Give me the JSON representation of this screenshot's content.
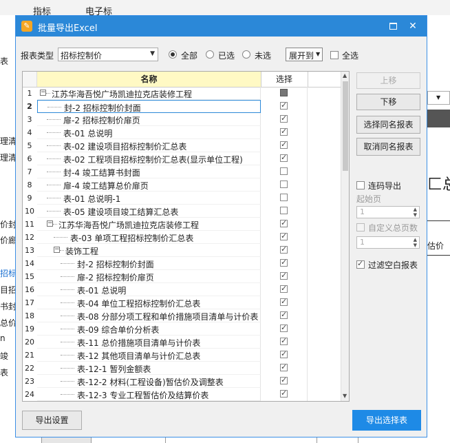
{
  "background": {
    "tabs": [
      "指标",
      "电子标"
    ],
    "left_fragments": [
      {
        "text": "表",
        "blue": false
      },
      {
        "text": "理清",
        "blue": false
      },
      {
        "text": "理清",
        "blue": false
      },
      {
        "text": "价封",
        "blue": false
      },
      {
        "text": "价廊",
        "blue": false
      },
      {
        "text": "招标",
        "blue": true
      },
      {
        "text": "目招",
        "blue": false
      },
      {
        "text": "书封",
        "blue": false
      },
      {
        "text": "总价",
        "blue": false
      },
      {
        "text": "n",
        "blue": false
      },
      {
        "text": "竣",
        "blue": false
      },
      {
        "text": "表",
        "blue": false
      }
    ],
    "right_fragments": [
      "匚总",
      "估价"
    ]
  },
  "dialog": {
    "title": "批量导出Excel",
    "report_type_label": "报表类型",
    "report_type_value": "招标控制价",
    "radio_all": "全部",
    "radio_selected": "已选",
    "radio_unselected": "未选",
    "expand_label": "展开到",
    "select_all_label": "全选",
    "grid": {
      "col_name": "名称",
      "col_select": "选择",
      "rows": [
        {
          "no": "1",
          "level": 0,
          "toggle": "−",
          "text": "江苏华海吾悦广场凯迪拉克店装修工程",
          "state": "partial"
        },
        {
          "no": "2",
          "level": 1,
          "toggle": "",
          "text": "封-2 招标控制价封面",
          "state": "on",
          "current": true
        },
        {
          "no": "3",
          "level": 1,
          "toggle": "",
          "text": "扉-2 招标控制价扉页",
          "state": "on"
        },
        {
          "no": "4",
          "level": 1,
          "toggle": "",
          "text": "表-01 总说明",
          "state": "on"
        },
        {
          "no": "5",
          "level": 1,
          "toggle": "",
          "text": "表-02 建设项目招标控制价汇总表",
          "state": "on"
        },
        {
          "no": "6",
          "level": 1,
          "toggle": "",
          "text": "表-02 工程项目招标控制价汇总表(显示单位工程)",
          "state": "on"
        },
        {
          "no": "7",
          "level": 1,
          "toggle": "",
          "text": "封-4 竣工结算书封面",
          "state": "off"
        },
        {
          "no": "8",
          "level": 1,
          "toggle": "",
          "text": "扉-4 竣工结算总价扉页",
          "state": "off"
        },
        {
          "no": "9",
          "level": 1,
          "toggle": "",
          "text": "表-01 总说明-1",
          "state": "off"
        },
        {
          "no": "10",
          "level": 1,
          "toggle": "",
          "text": "表-05 建设项目竣工结算汇总表",
          "state": "off"
        },
        {
          "no": "11",
          "level": 1,
          "toggle": "−",
          "text": "江苏华海吾悦广场凯迪拉克店装修工程",
          "state": "on"
        },
        {
          "no": "12",
          "level": 2,
          "toggle": "",
          "text": "表-03 单项工程招标控制价汇总表",
          "state": "on"
        },
        {
          "no": "13",
          "level": 2,
          "toggle": "−",
          "text": "装饰工程",
          "state": "on"
        },
        {
          "no": "14",
          "level": 3,
          "toggle": "",
          "text": "封-2 招标控制价封面",
          "state": "on"
        },
        {
          "no": "15",
          "level": 3,
          "toggle": "",
          "text": "扉-2 招标控制价扉页",
          "state": "on"
        },
        {
          "no": "16",
          "level": 3,
          "toggle": "",
          "text": "表-01 总说明",
          "state": "on"
        },
        {
          "no": "17",
          "level": 3,
          "toggle": "",
          "text": "表-04 单位工程招标控制价汇总表",
          "state": "on"
        },
        {
          "no": "18",
          "level": 3,
          "toggle": "",
          "text": "表-08 分部分项工程和单价措施项目清单与计价表",
          "state": "on"
        },
        {
          "no": "19",
          "level": 3,
          "toggle": "",
          "text": "表-09 综合单价分析表",
          "state": "on"
        },
        {
          "no": "20",
          "level": 3,
          "toggle": "",
          "text": "表-11 总价措施项目清单与计价表",
          "state": "on"
        },
        {
          "no": "21",
          "level": 3,
          "toggle": "",
          "text": "表-12 其他项目清单与计价汇总表",
          "state": "on"
        },
        {
          "no": "22",
          "level": 3,
          "toggle": "",
          "text": "表-12-1 暂列金额表",
          "state": "on"
        },
        {
          "no": "23",
          "level": 3,
          "toggle": "",
          "text": "表-12-2 材料(工程设备)暂估价及调整表",
          "state": "on"
        },
        {
          "no": "24",
          "level": 3,
          "toggle": "",
          "text": "表-12-3 专业工程暂估价及结算价表",
          "state": "on"
        }
      ]
    },
    "btn_move_up": "上移",
    "btn_move_down": "下移",
    "btn_select_same": "选择同名报表",
    "btn_cancel_same": "取消同名报表",
    "continuous_export_label": "连码导出",
    "start_page_label": "起始页",
    "start_page_value": "1",
    "custom_total_label": "自定义总页数",
    "custom_total_value": "1",
    "filter_blank_label": "过滤空白报表",
    "btn_export_settings": "导出设置",
    "btn_export_selected": "导出选择表",
    "colors": {
      "title_bar": "#2b88d8",
      "primary_button": "#1e8ae6",
      "header_highlight": "#fff9c4"
    }
  }
}
